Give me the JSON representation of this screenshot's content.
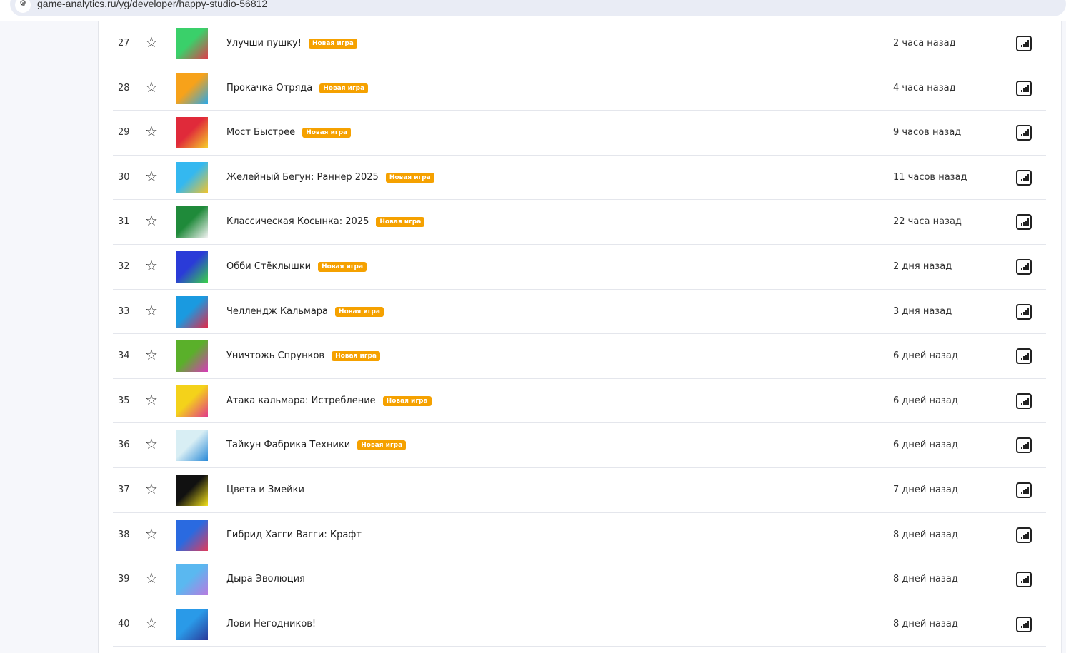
{
  "browser": {
    "url": "game-analytics.ru/yg/developer/happy-studio-56812"
  },
  "badge_label": "Новая игра",
  "rows": [
    {
      "rank": "27",
      "name": "Улучши пушку!",
      "new": true,
      "time": "2 часа назад",
      "colors": [
        "#3ad06a",
        "#e23a4a"
      ]
    },
    {
      "rank": "28",
      "name": "Прокачка Отряда",
      "new": true,
      "time": "4 часа назад",
      "colors": [
        "#f7a21a",
        "#2aa8e8"
      ]
    },
    {
      "rank": "29",
      "name": "Мост Быстрее",
      "new": true,
      "time": "9 часов назад",
      "colors": [
        "#e02a3a",
        "#f6d02a"
      ]
    },
    {
      "rank": "30",
      "name": "Желейный Бегун: Раннер 2025",
      "new": true,
      "time": "11 часов назад",
      "colors": [
        "#34b8f0",
        "#f4c42a"
      ]
    },
    {
      "rank": "31",
      "name": "Классическая Косынка: 2025",
      "new": true,
      "time": "22 часа назад",
      "colors": [
        "#1f8a3a",
        "#f2f2f2"
      ]
    },
    {
      "rank": "32",
      "name": "Обби Стёклышки",
      "new": true,
      "time": "2 дня назад",
      "colors": [
        "#2a3bd8",
        "#3ad04a"
      ]
    },
    {
      "rank": "33",
      "name": "Челлендж Кальмара",
      "new": true,
      "time": "3 дня назад",
      "colors": [
        "#1a9ae0",
        "#e02a4a"
      ]
    },
    {
      "rank": "34",
      "name": "Уничтожь Спрунков",
      "new": true,
      "time": "6 дней назад",
      "colors": [
        "#5ab02a",
        "#d83ab8"
      ]
    },
    {
      "rank": "35",
      "name": "Атака кальмара: Истребление",
      "new": true,
      "time": "6 дней назад",
      "colors": [
        "#f4d21a",
        "#e23a8a"
      ]
    },
    {
      "rank": "36",
      "name": "Тайкун Фабрика Техники",
      "new": true,
      "time": "6 дней назад",
      "colors": [
        "#d8eef4",
        "#2a8ad8"
      ]
    },
    {
      "rank": "37",
      "name": "Цвета и Змейки",
      "new": false,
      "time": "7 дней назад",
      "colors": [
        "#111111",
        "#f4e21a"
      ]
    },
    {
      "rank": "38",
      "name": "Гибрид Хагги Вагги: Крафт",
      "new": false,
      "time": "8 дней назад",
      "colors": [
        "#2a6ae0",
        "#e23a5a"
      ]
    },
    {
      "rank": "39",
      "name": "Дыра Эволюция",
      "new": false,
      "time": "8 дней назад",
      "colors": [
        "#5ab8f0",
        "#b87ae0"
      ]
    },
    {
      "rank": "40",
      "name": "Лови Негодников!",
      "new": false,
      "time": "8 дней назад",
      "colors": [
        "#2a9ae8",
        "#2a3a9a"
      ]
    }
  ]
}
